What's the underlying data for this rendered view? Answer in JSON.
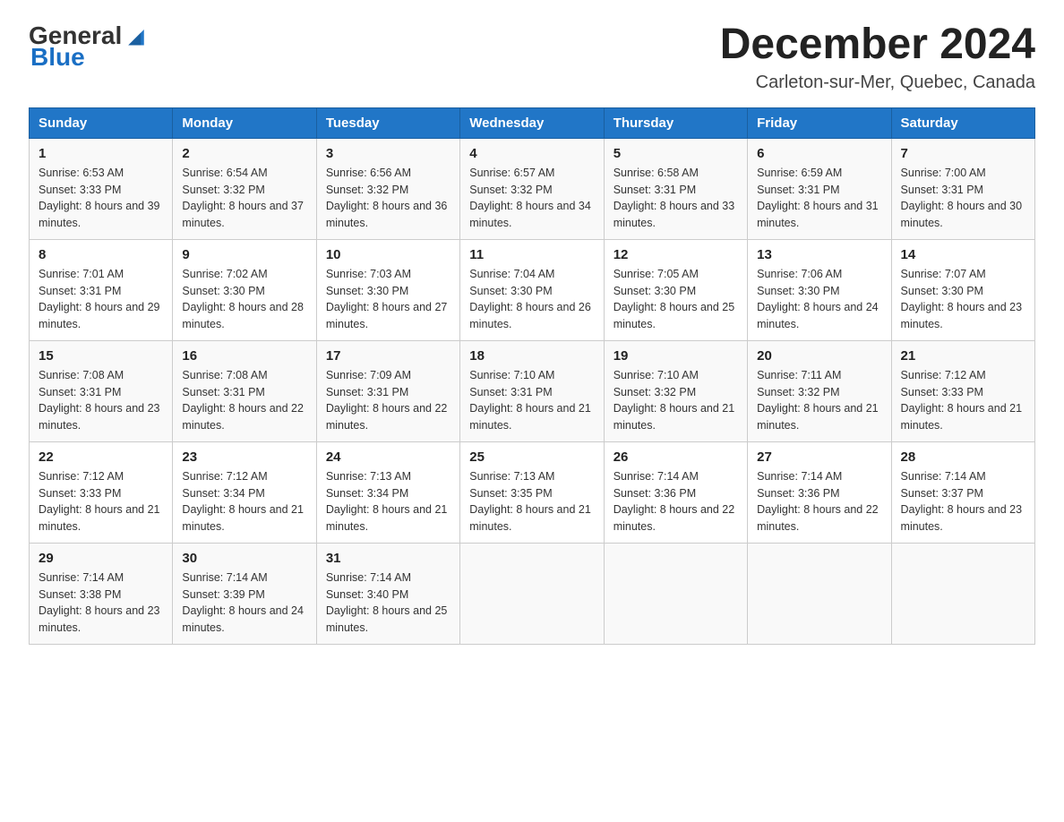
{
  "header": {
    "logo_general": "General",
    "logo_blue": "Blue",
    "month_title": "December 2024",
    "location": "Carleton-sur-Mer, Quebec, Canada"
  },
  "days_of_week": [
    "Sunday",
    "Monday",
    "Tuesday",
    "Wednesday",
    "Thursday",
    "Friday",
    "Saturday"
  ],
  "weeks": [
    [
      {
        "day": "1",
        "sunrise": "6:53 AM",
        "sunset": "3:33 PM",
        "daylight": "8 hours and 39 minutes."
      },
      {
        "day": "2",
        "sunrise": "6:54 AM",
        "sunset": "3:32 PM",
        "daylight": "8 hours and 37 minutes."
      },
      {
        "day": "3",
        "sunrise": "6:56 AM",
        "sunset": "3:32 PM",
        "daylight": "8 hours and 36 minutes."
      },
      {
        "day": "4",
        "sunrise": "6:57 AM",
        "sunset": "3:32 PM",
        "daylight": "8 hours and 34 minutes."
      },
      {
        "day": "5",
        "sunrise": "6:58 AM",
        "sunset": "3:31 PM",
        "daylight": "8 hours and 33 minutes."
      },
      {
        "day": "6",
        "sunrise": "6:59 AM",
        "sunset": "3:31 PM",
        "daylight": "8 hours and 31 minutes."
      },
      {
        "day": "7",
        "sunrise": "7:00 AM",
        "sunset": "3:31 PM",
        "daylight": "8 hours and 30 minutes."
      }
    ],
    [
      {
        "day": "8",
        "sunrise": "7:01 AM",
        "sunset": "3:31 PM",
        "daylight": "8 hours and 29 minutes."
      },
      {
        "day": "9",
        "sunrise": "7:02 AM",
        "sunset": "3:30 PM",
        "daylight": "8 hours and 28 minutes."
      },
      {
        "day": "10",
        "sunrise": "7:03 AM",
        "sunset": "3:30 PM",
        "daylight": "8 hours and 27 minutes."
      },
      {
        "day": "11",
        "sunrise": "7:04 AM",
        "sunset": "3:30 PM",
        "daylight": "8 hours and 26 minutes."
      },
      {
        "day": "12",
        "sunrise": "7:05 AM",
        "sunset": "3:30 PM",
        "daylight": "8 hours and 25 minutes."
      },
      {
        "day": "13",
        "sunrise": "7:06 AM",
        "sunset": "3:30 PM",
        "daylight": "8 hours and 24 minutes."
      },
      {
        "day": "14",
        "sunrise": "7:07 AM",
        "sunset": "3:30 PM",
        "daylight": "8 hours and 23 minutes."
      }
    ],
    [
      {
        "day": "15",
        "sunrise": "7:08 AM",
        "sunset": "3:31 PM",
        "daylight": "8 hours and 23 minutes."
      },
      {
        "day": "16",
        "sunrise": "7:08 AM",
        "sunset": "3:31 PM",
        "daylight": "8 hours and 22 minutes."
      },
      {
        "day": "17",
        "sunrise": "7:09 AM",
        "sunset": "3:31 PM",
        "daylight": "8 hours and 22 minutes."
      },
      {
        "day": "18",
        "sunrise": "7:10 AM",
        "sunset": "3:31 PM",
        "daylight": "8 hours and 21 minutes."
      },
      {
        "day": "19",
        "sunrise": "7:10 AM",
        "sunset": "3:32 PM",
        "daylight": "8 hours and 21 minutes."
      },
      {
        "day": "20",
        "sunrise": "7:11 AM",
        "sunset": "3:32 PM",
        "daylight": "8 hours and 21 minutes."
      },
      {
        "day": "21",
        "sunrise": "7:12 AM",
        "sunset": "3:33 PM",
        "daylight": "8 hours and 21 minutes."
      }
    ],
    [
      {
        "day": "22",
        "sunrise": "7:12 AM",
        "sunset": "3:33 PM",
        "daylight": "8 hours and 21 minutes."
      },
      {
        "day": "23",
        "sunrise": "7:12 AM",
        "sunset": "3:34 PM",
        "daylight": "8 hours and 21 minutes."
      },
      {
        "day": "24",
        "sunrise": "7:13 AM",
        "sunset": "3:34 PM",
        "daylight": "8 hours and 21 minutes."
      },
      {
        "day": "25",
        "sunrise": "7:13 AM",
        "sunset": "3:35 PM",
        "daylight": "8 hours and 21 minutes."
      },
      {
        "day": "26",
        "sunrise": "7:14 AM",
        "sunset": "3:36 PM",
        "daylight": "8 hours and 22 minutes."
      },
      {
        "day": "27",
        "sunrise": "7:14 AM",
        "sunset": "3:36 PM",
        "daylight": "8 hours and 22 minutes."
      },
      {
        "day": "28",
        "sunrise": "7:14 AM",
        "sunset": "3:37 PM",
        "daylight": "8 hours and 23 minutes."
      }
    ],
    [
      {
        "day": "29",
        "sunrise": "7:14 AM",
        "sunset": "3:38 PM",
        "daylight": "8 hours and 23 minutes."
      },
      {
        "day": "30",
        "sunrise": "7:14 AM",
        "sunset": "3:39 PM",
        "daylight": "8 hours and 24 minutes."
      },
      {
        "day": "31",
        "sunrise": "7:14 AM",
        "sunset": "3:40 PM",
        "daylight": "8 hours and 25 minutes."
      },
      null,
      null,
      null,
      null
    ]
  ]
}
